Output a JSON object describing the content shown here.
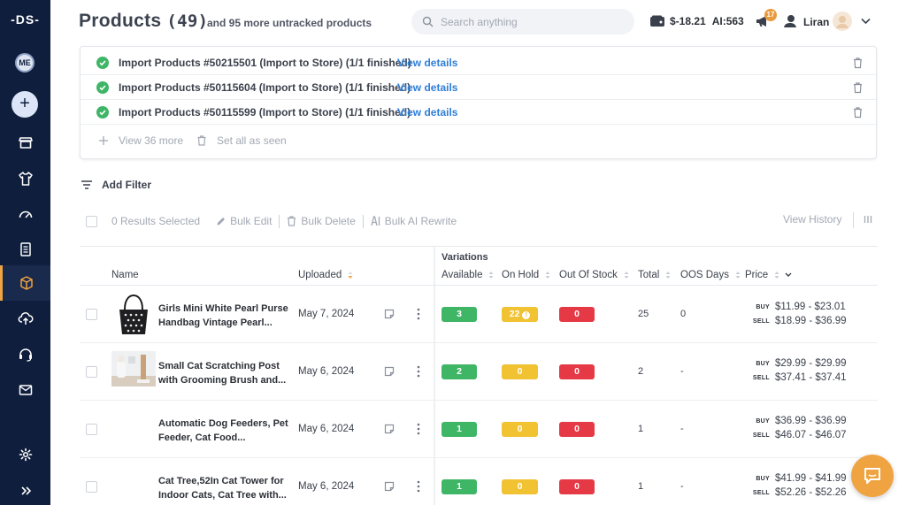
{
  "sidebar": {
    "logo": "-DS-",
    "avatar_initials": "ME",
    "add_label": "+",
    "items": [
      {
        "icon": "store-icon"
      },
      {
        "icon": "shirt-icon"
      },
      {
        "icon": "dashboard-icon"
      },
      {
        "icon": "orders-icon"
      },
      {
        "icon": "products-icon",
        "active": true
      },
      {
        "icon": "cloud-upload-icon"
      },
      {
        "icon": "support-icon"
      },
      {
        "icon": "mail-icon"
      },
      {
        "icon": "settings-icon"
      },
      {
        "icon": "expand-icon"
      }
    ]
  },
  "header": {
    "title": "Products",
    "count": "(49)",
    "subtitle": "and 95 more untracked products",
    "search_placeholder": "Search anything",
    "balance": "$-18.21",
    "ai_credits": "AI:563",
    "notif_count": "17",
    "user_name": "Liran"
  },
  "notifications": {
    "items": [
      {
        "message": "Import Products #50215501 (Import to Store) (1/1 finished)",
        "link": "View details"
      },
      {
        "message": "Import Products #50115604 (Import to Store) (1/1 finished)",
        "link": "View details"
      },
      {
        "message": "Import Products #50115599 (Import to Store) (1/1 finished)",
        "link": "View details"
      }
    ],
    "view_more": "View 36 more",
    "set_all_seen": "Set all as seen"
  },
  "filters": {
    "add_filter": "Add Filter"
  },
  "bulk": {
    "selected": "0 Results Selected",
    "edit": "Bulk Edit",
    "delete": "Bulk Delete",
    "ai_rewrite": "Bulk AI Rewrite",
    "view_history": "View History"
  },
  "table": {
    "group_header": "Variations",
    "columns": {
      "name": "Name",
      "uploaded": "Uploaded",
      "available": "Available",
      "on_hold": "On Hold",
      "out_of_stock": "Out Of Stock",
      "total": "Total",
      "oos_days": "OOS Days",
      "price": "Price"
    },
    "buy_tag": "BUY",
    "sell_tag": "SELL",
    "rows": [
      {
        "name": "Girls Mini White Pearl Purse Handbag Vintage Pearl...",
        "uploaded": "May 7, 2024",
        "available": "3",
        "on_hold": "22",
        "out_of_stock": "0",
        "total": "25",
        "oos_days": "0",
        "buy": "$11.99 - $23.01",
        "sell": "$18.99 - $36.99",
        "thumb": "handbag"
      },
      {
        "name": "Small Cat Scratching Post with Grooming Brush and...",
        "uploaded": "May 6, 2024",
        "available": "2",
        "on_hold": "0",
        "out_of_stock": "0",
        "total": "2",
        "oos_days": "-",
        "buy": "$29.99 - $29.99",
        "sell": "$37.41 - $37.41",
        "thumb": "cat-post"
      },
      {
        "name": "Automatic Dog Feeders, Pet Feeder, Cat Food...",
        "uploaded": "May 6, 2024",
        "available": "1",
        "on_hold": "0",
        "out_of_stock": "0",
        "total": "1",
        "oos_days": "-",
        "buy": "$36.99 - $36.99",
        "sell": "$46.07 - $46.07",
        "thumb": ""
      },
      {
        "name": "Cat Tree,52In Cat Tower for Indoor Cats, Cat Tree with...",
        "uploaded": "May 6, 2024",
        "available": "1",
        "on_hold": "0",
        "out_of_stock": "0",
        "total": "1",
        "oos_days": "-",
        "buy": "$41.99 - $41.99",
        "sell": "$52.26 - $52.26",
        "thumb": ""
      }
    ]
  },
  "colors": {
    "sidebar_bg": "#0f1e3d",
    "accent": "#f0a341",
    "link": "#2f7ed8",
    "success": "#3fb566",
    "warning": "#f1c232",
    "danger": "#e63946"
  }
}
